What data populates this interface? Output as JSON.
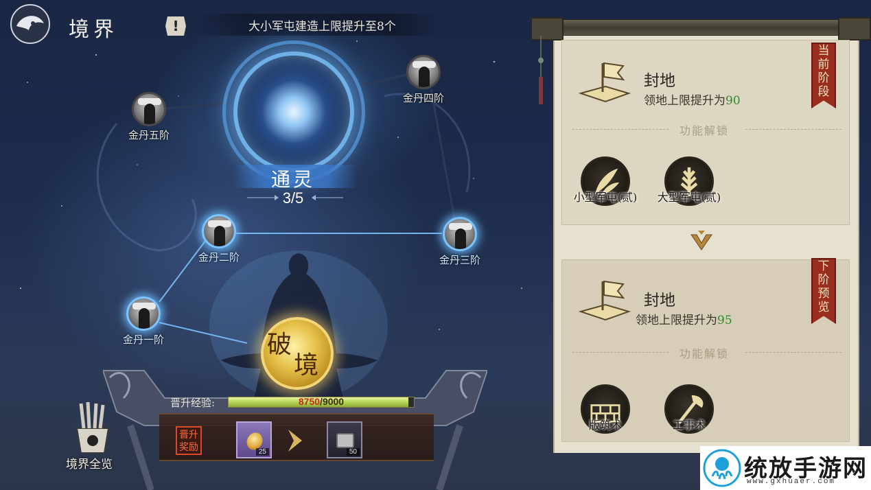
{
  "header": {
    "title": "境界",
    "alert_icon": "exclamation-icon",
    "alert_glyph": "!",
    "banner": "大小军屯建造上限提升至8个"
  },
  "realm": {
    "current_name": "通灵",
    "progress": "3/5",
    "nodes": [
      {
        "label": "金丹一阶",
        "lit": true
      },
      {
        "label": "金丹二阶",
        "lit": true
      },
      {
        "label": "金丹三阶",
        "lit": true
      },
      {
        "label": "金丹四阶",
        "lit": false
      },
      {
        "label": "金丹五阶",
        "lit": false
      }
    ]
  },
  "breakthrough": {
    "char1": "破",
    "char2": "境"
  },
  "xp": {
    "label": "晋升经验:",
    "current": "8750",
    "separator": "/",
    "max": "9000",
    "fraction": 0.972
  },
  "reward": {
    "tag": "晋升奖励",
    "tag_line1": "晋升",
    "tag_line2": "奖励",
    "items": [
      {
        "icon": "gold-coin-icon",
        "count": "25"
      },
      {
        "icon": "treasure-chest-icon",
        "count": "50"
      }
    ]
  },
  "overview": {
    "label": "境界全览",
    "icon": "scroll-holder-icon"
  },
  "panel": {
    "current": {
      "ribbon": [
        "当",
        "前",
        "阶",
        "段"
      ],
      "title": "封地",
      "desc_prefix": "领地上限提升为",
      "desc_value": "90",
      "unlock_title": "功能解锁",
      "features": [
        {
          "label": "小型军屯(贰)",
          "icon": "leaf-icon"
        },
        {
          "label": "大型军屯(贰)",
          "icon": "wheat-icon"
        }
      ]
    },
    "next": {
      "ribbon": [
        "下",
        "阶",
        "预",
        "览"
      ],
      "title": "封地",
      "desc_prefix": "领地上限提升为",
      "desc_value": "95",
      "unlock_title": "功能解锁",
      "features": [
        {
          "label": "版筑术",
          "icon": "wall-building-icon"
        },
        {
          "label": "工事术",
          "icon": "axe-icon"
        }
      ]
    }
  },
  "watermark": {
    "text": "统放手游网",
    "url": "www.gxhuaer.com"
  },
  "colors": {
    "accent_blue": "#6fb0e6",
    "gold": "#e6c24a",
    "ribbon_red": "#9a2e1e",
    "value_green": "#2f8a2a",
    "xp_current_red": "#c52a1a"
  }
}
